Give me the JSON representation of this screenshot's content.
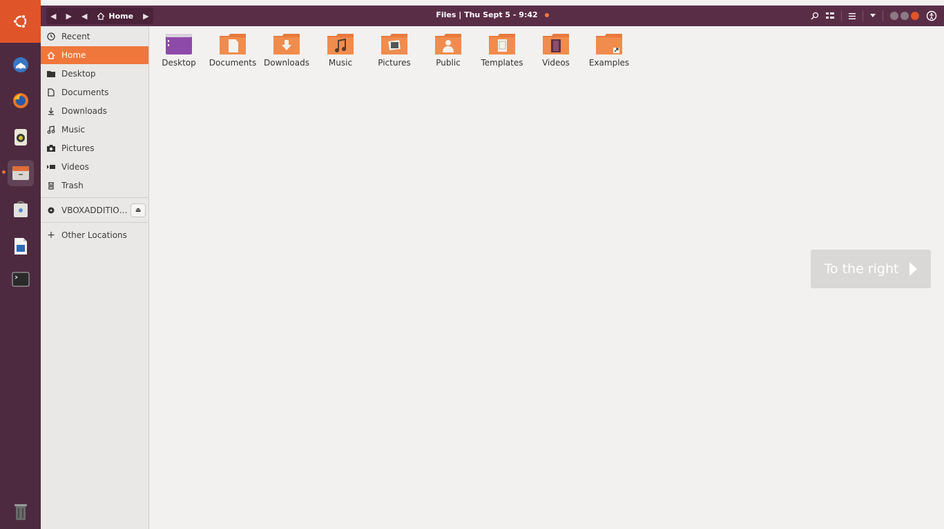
{
  "window": {
    "title": "Files | Thu Sept 5 - 9:42",
    "path_current": "Home"
  },
  "topbar": {
    "back_label": "◀",
    "forward_label": "▶",
    "path_prev_label": "◀",
    "path_next_label": "▶"
  },
  "launcher": {
    "apps": [
      "ubuntu-logo",
      "thunderbird",
      "firefox",
      "rhythmbox",
      "files",
      "software",
      "writer",
      "terminal",
      "trash"
    ],
    "active": "files"
  },
  "sidebar": {
    "items": [
      {
        "label": "Recent",
        "icon": "clock-icon"
      },
      {
        "label": "Home",
        "icon": "home-icon"
      },
      {
        "label": "Desktop",
        "icon": "folder-icon"
      },
      {
        "label": "Documents",
        "icon": "document-icon"
      },
      {
        "label": "Downloads",
        "icon": "download-icon"
      },
      {
        "label": "Music",
        "icon": "music-icon"
      },
      {
        "label": "Pictures",
        "icon": "camera-icon"
      },
      {
        "label": "Videos",
        "icon": "video-icon"
      },
      {
        "label": "Trash",
        "icon": "trash-icon"
      }
    ],
    "device": {
      "label": "VBOXADDITIO…",
      "icon": "disc-icon"
    },
    "other_locations": "Other Locations"
  },
  "main": {
    "folders": [
      {
        "label": "Desktop"
      },
      {
        "label": "Documents"
      },
      {
        "label": "Downloads"
      },
      {
        "label": "Music"
      },
      {
        "label": "Pictures"
      },
      {
        "label": "Public"
      },
      {
        "label": "Templates"
      },
      {
        "label": "Videos"
      },
      {
        "label": "Examples"
      }
    ],
    "overlay_button": "To the right"
  },
  "colors": {
    "accent": "#f0773c",
    "launcher_bg": "#4d2a3f",
    "topbar_bg": "#5a2d47",
    "sidebar_bg": "#e9e8e6",
    "main_bg": "#f2f1f0"
  }
}
